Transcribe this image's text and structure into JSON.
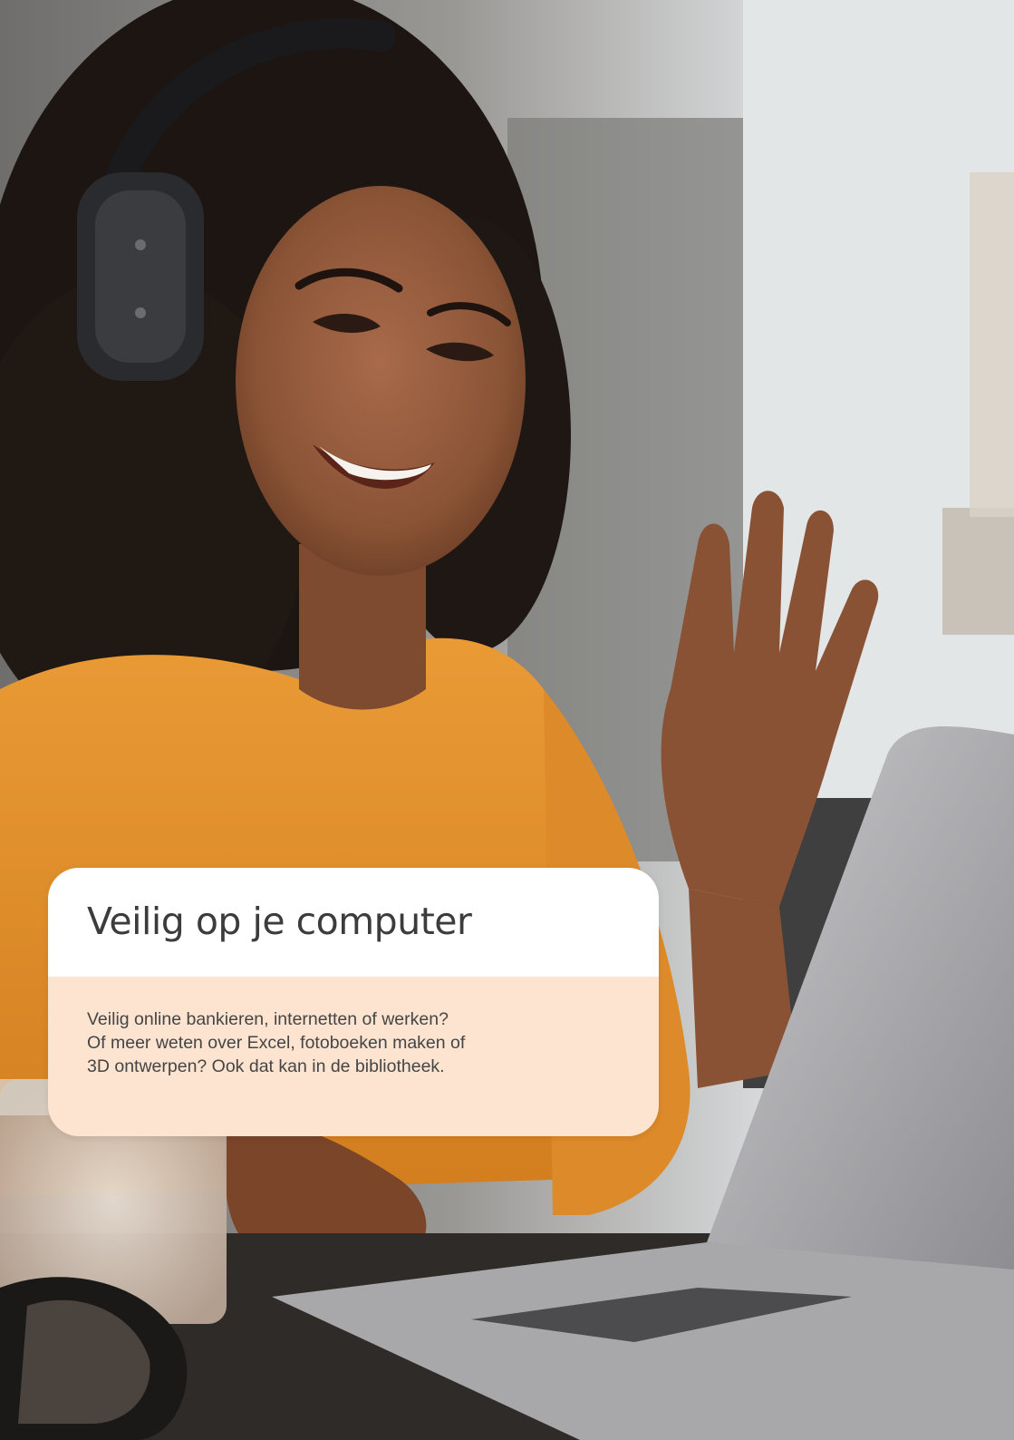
{
  "card": {
    "title": "Veilig op je computer",
    "lines": [
      "Veilig online bankieren, internetten of werken?",
      "Of meer weten over Excel, fotoboeken maken of",
      "3D ontwerpen? Ook dat kan in de bibliotheek."
    ]
  },
  "colors": {
    "card_header": "#ffffff",
    "card_body": "#fde4d0",
    "title_text": "#3c3c3c",
    "body_text": "#454545"
  }
}
